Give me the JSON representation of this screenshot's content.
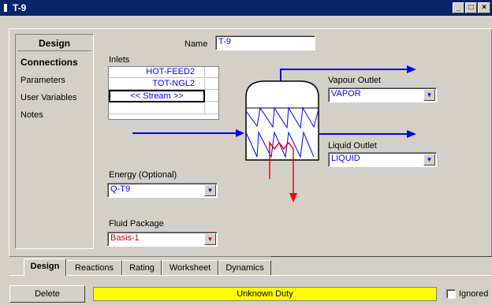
{
  "window": {
    "title": "T-9",
    "min_label": "_",
    "max_label": "□",
    "close_label": "×"
  },
  "nav": {
    "header": "Design",
    "items": [
      "Connections",
      "Parameters",
      "User Variables",
      "Notes"
    ]
  },
  "name_field": {
    "label": "Name",
    "value": "T-9"
  },
  "inlets": {
    "label": "Inlets",
    "streams": [
      "HOT-FEED2",
      "TOT-NGL2",
      "<< Stream >>",
      ""
    ]
  },
  "vapour_outlet": {
    "label": "Vapour Outlet",
    "value": "VAPOR"
  },
  "liquid_outlet": {
    "label": "Liquid Outlet",
    "value": "LIQUID"
  },
  "energy": {
    "label": "Energy (Optional)",
    "value": "Q-T9"
  },
  "fluid_package": {
    "label": "Fluid Package",
    "value": "Basis-1"
  },
  "tabs": [
    "Design",
    "Reactions",
    "Rating",
    "Worksheet",
    "Dynamics"
  ],
  "footer": {
    "delete_label": "Delete",
    "status_text": "Unknown Duty",
    "ignored_label": "Ignored"
  },
  "colors": {
    "stream_blue": "#0000ff",
    "energy_red": "#ff0000",
    "status_yellow": "#ffff00",
    "titlebar": "#0a246a"
  }
}
